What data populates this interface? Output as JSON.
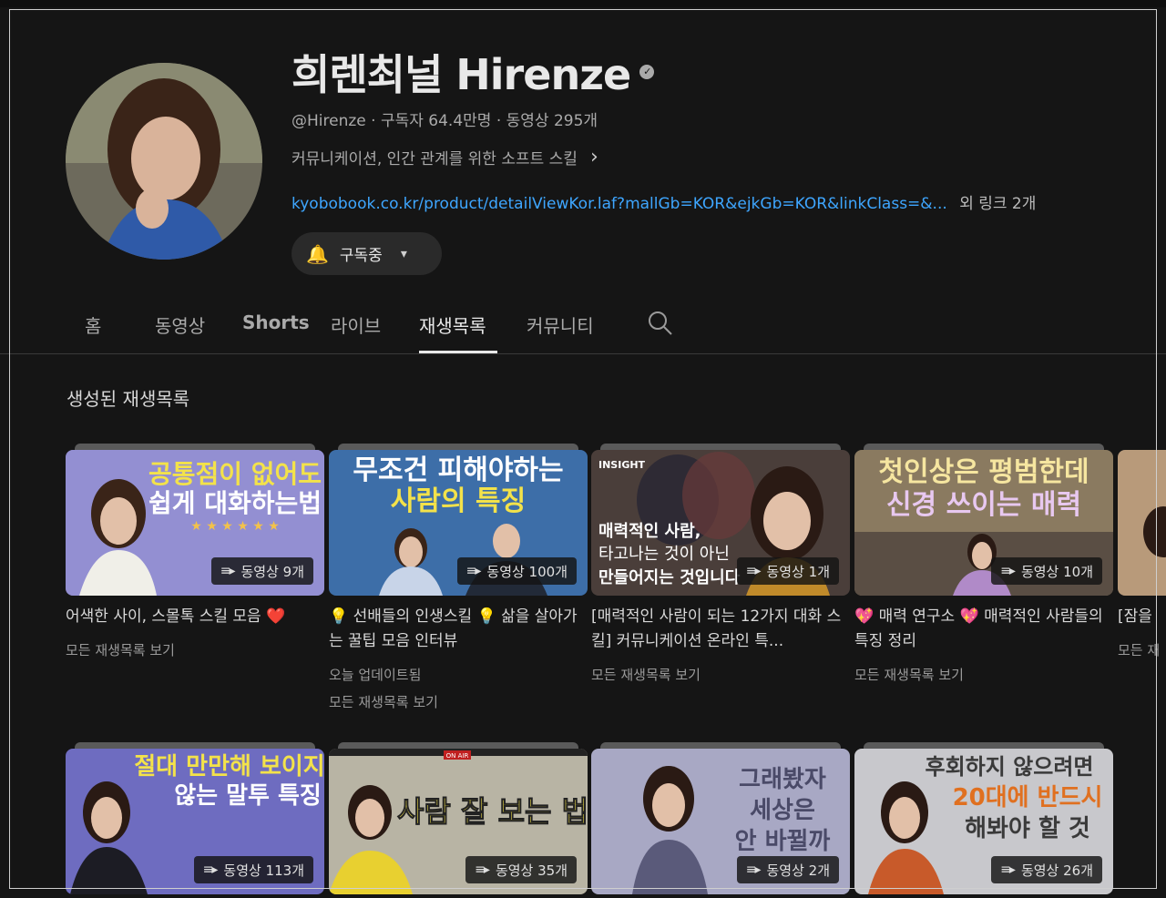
{
  "channel": {
    "name": "희렌최널 Hirenze",
    "handle": "@Hirenze",
    "subscribers": "구독자 64.4만명",
    "videos": "동영상 295개",
    "description": "커뮤니케이션, 인간 관계를 위한 소프트 스킬",
    "link": "kyobobook.co.kr/product/detailViewKor.laf?mallGb=KOR&ejkGb=KOR&linkClass=&...",
    "more_links": "외 링크 2개",
    "subscribe_label": "구독중"
  },
  "tabs": [
    {
      "label": "홈"
    },
    {
      "label": "동영상"
    },
    {
      "label": "Shorts"
    },
    {
      "label": "라이브"
    },
    {
      "label": "재생목록"
    },
    {
      "label": "커뮤니티"
    }
  ],
  "section_title": "생성된 재생목록",
  "playlists": [
    {
      "thumb_text": [
        "공통점이 없어도",
        "쉽게 대화하는법"
      ],
      "count": "동영상 9개",
      "title": "어색한 사이, 스몰톡 스킬 모음 ❤️",
      "updated": "",
      "view_all": "모든 재생목록 보기"
    },
    {
      "thumb_text": [
        "무조건 피해야하는",
        "사람의 특징"
      ],
      "count": "동영상 100개",
      "title": "💡 선배들의 인생스킬 💡 삶을 살아가는 꿀팁 모음 인터뷰",
      "updated": "오늘 업데이트됨",
      "view_all": "모든 재생목록 보기"
    },
    {
      "thumb_text": [
        "매력적인 사람,",
        "타고나는 것이 아닌",
        "만들어지는 것입니다"
      ],
      "thumb_brand": "INSIGHT",
      "count": "동영상 1개",
      "title": "[매력적인 사람이 되는 12가지 대화 스킬] 커뮤니케이션 온라인 특...",
      "updated": "",
      "view_all": "모든 재생목록 보기"
    },
    {
      "thumb_text": [
        "첫인상은 평범한데",
        "신경 쓰이는 매력"
      ],
      "count": "동영상 10개",
      "title": "💖 매력 연구소 💖 매력적인 사람들의 특징 정리",
      "updated": "",
      "view_all": "모든 재생목록 보기"
    },
    {
      "thumb_text": [
        "절대 만만해 보이지",
        "않는 말투 특징"
      ],
      "count": "동영상 113개"
    },
    {
      "thumb_text": [
        "사람 잘 보는 법"
      ],
      "thumb_tag": "ON AIR",
      "count": "동영상 35개"
    },
    {
      "thumb_text": [
        "그래봤자",
        "세상은",
        "안 바뀔까"
      ],
      "count": "동영상 2개"
    },
    {
      "thumb_text": [
        "후회하지 않으려면",
        "20대에 반드시",
        "해봐야 할 것"
      ],
      "count": "동영상 26개"
    }
  ],
  "partial_card": {
    "title": "[잠을",
    "view_all": "모든 재"
  },
  "icons": {
    "search": "search-icon",
    "bell": "bell-icon",
    "playlist": "playlist-icon",
    "verified": "verified-icon"
  },
  "colors": {
    "background": "#151515",
    "link": "#3ea6ff"
  }
}
